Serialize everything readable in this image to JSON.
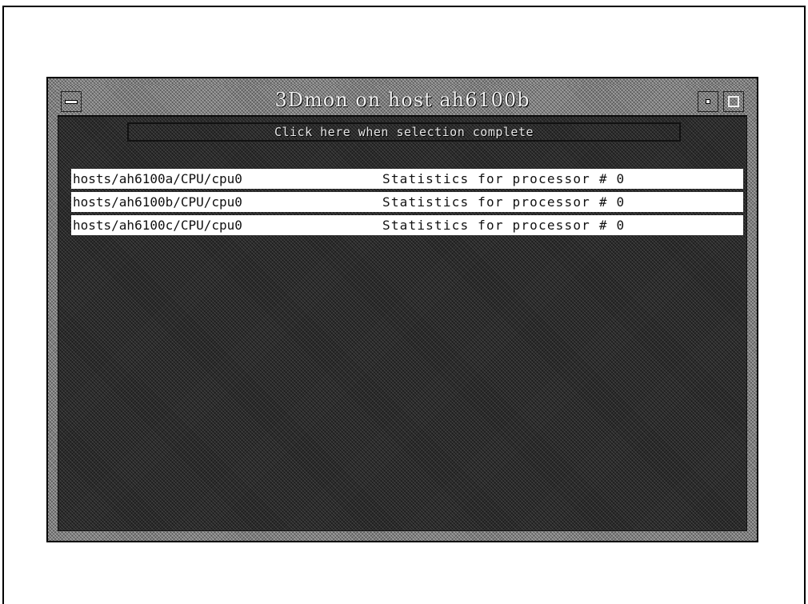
{
  "window": {
    "title": "3Dmon on host ah6100b"
  },
  "selection": {
    "button_label": "Click here when selection complete"
  },
  "list": {
    "items": [
      {
        "path": "hosts/ah6100a/CPU/cpu0",
        "description": "Statistics for processor # 0"
      },
      {
        "path": "hosts/ah6100b/CPU/cpu0",
        "description": "Statistics for processor # 0"
      },
      {
        "path": "hosts/ah6100c/CPU/cpu0",
        "description": "Statistics for processor # 0"
      }
    ]
  },
  "icons": {
    "window_menu": "window-menu-icon",
    "minimize": "minimize-icon",
    "maximize": "maximize-icon"
  },
  "colors": {
    "page_background": "#ffffff",
    "window_frame": "#7d7d7d",
    "client_background": "#2a2a2a",
    "list_row_background": "#ffffff",
    "text_light": "#f2f2f2"
  }
}
